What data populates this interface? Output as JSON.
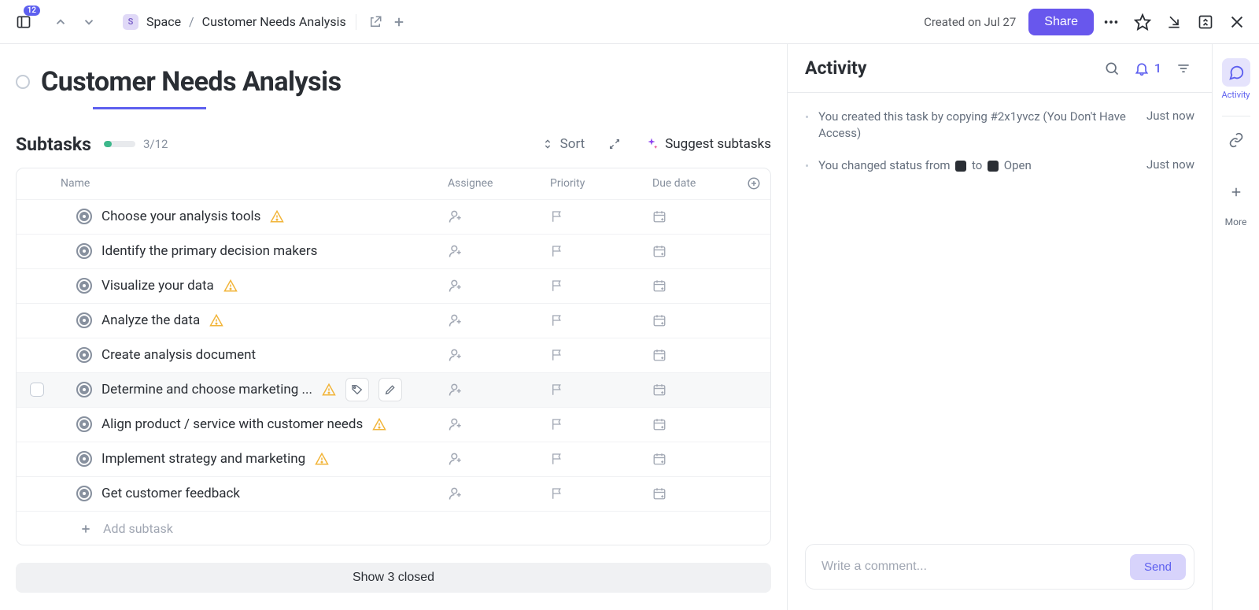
{
  "top": {
    "sidebar_count": "12",
    "space_badge": "S",
    "crumb1": "Space",
    "crumb_sep": "/",
    "crumb2": "Customer Needs Analysis",
    "created": "Created on Jul 27",
    "share": "Share"
  },
  "page": {
    "title": "Customer Needs Analysis"
  },
  "subtasks": {
    "label": "Subtasks",
    "progress_text": "3/12",
    "sort": "Sort",
    "suggest": "Suggest subtasks",
    "add_placeholder": "Add subtask",
    "show_closed": "Show 3 closed"
  },
  "columns": {
    "name": "Name",
    "assignee": "Assignee",
    "priority": "Priority",
    "due": "Due date"
  },
  "tasks": [
    {
      "title": "Choose your analysis tools",
      "warn": true,
      "hover": false
    },
    {
      "title": "Identify the primary decision makers",
      "warn": false,
      "hover": false
    },
    {
      "title": "Visualize your data",
      "warn": true,
      "hover": false
    },
    {
      "title": "Analyze the data",
      "warn": true,
      "hover": false
    },
    {
      "title": "Create analysis document",
      "warn": false,
      "hover": false
    },
    {
      "title": "Determine and choose marketing ...",
      "warn": true,
      "hover": true
    },
    {
      "title": "Align product / service with customer needs",
      "warn": true,
      "hover": false
    },
    {
      "title": "Implement strategy and marketing",
      "warn": true,
      "hover": false
    },
    {
      "title": "Get customer feedback",
      "warn": false,
      "hover": false
    }
  ],
  "activity": {
    "title": "Activity",
    "bell_count": "1",
    "items": [
      {
        "text_pre": "You created this task by copying #2x1yvcz (You Don't Have Access)",
        "time": "Just now",
        "status_change": false
      },
      {
        "text_pre": "You changed status from",
        "text_mid": "to",
        "text_post": "Open",
        "time": "Just now",
        "status_change": true
      }
    ],
    "comment_placeholder": "Write a comment...",
    "send": "Send"
  },
  "rail": {
    "activity_label": "Activity",
    "more_label": "More"
  }
}
